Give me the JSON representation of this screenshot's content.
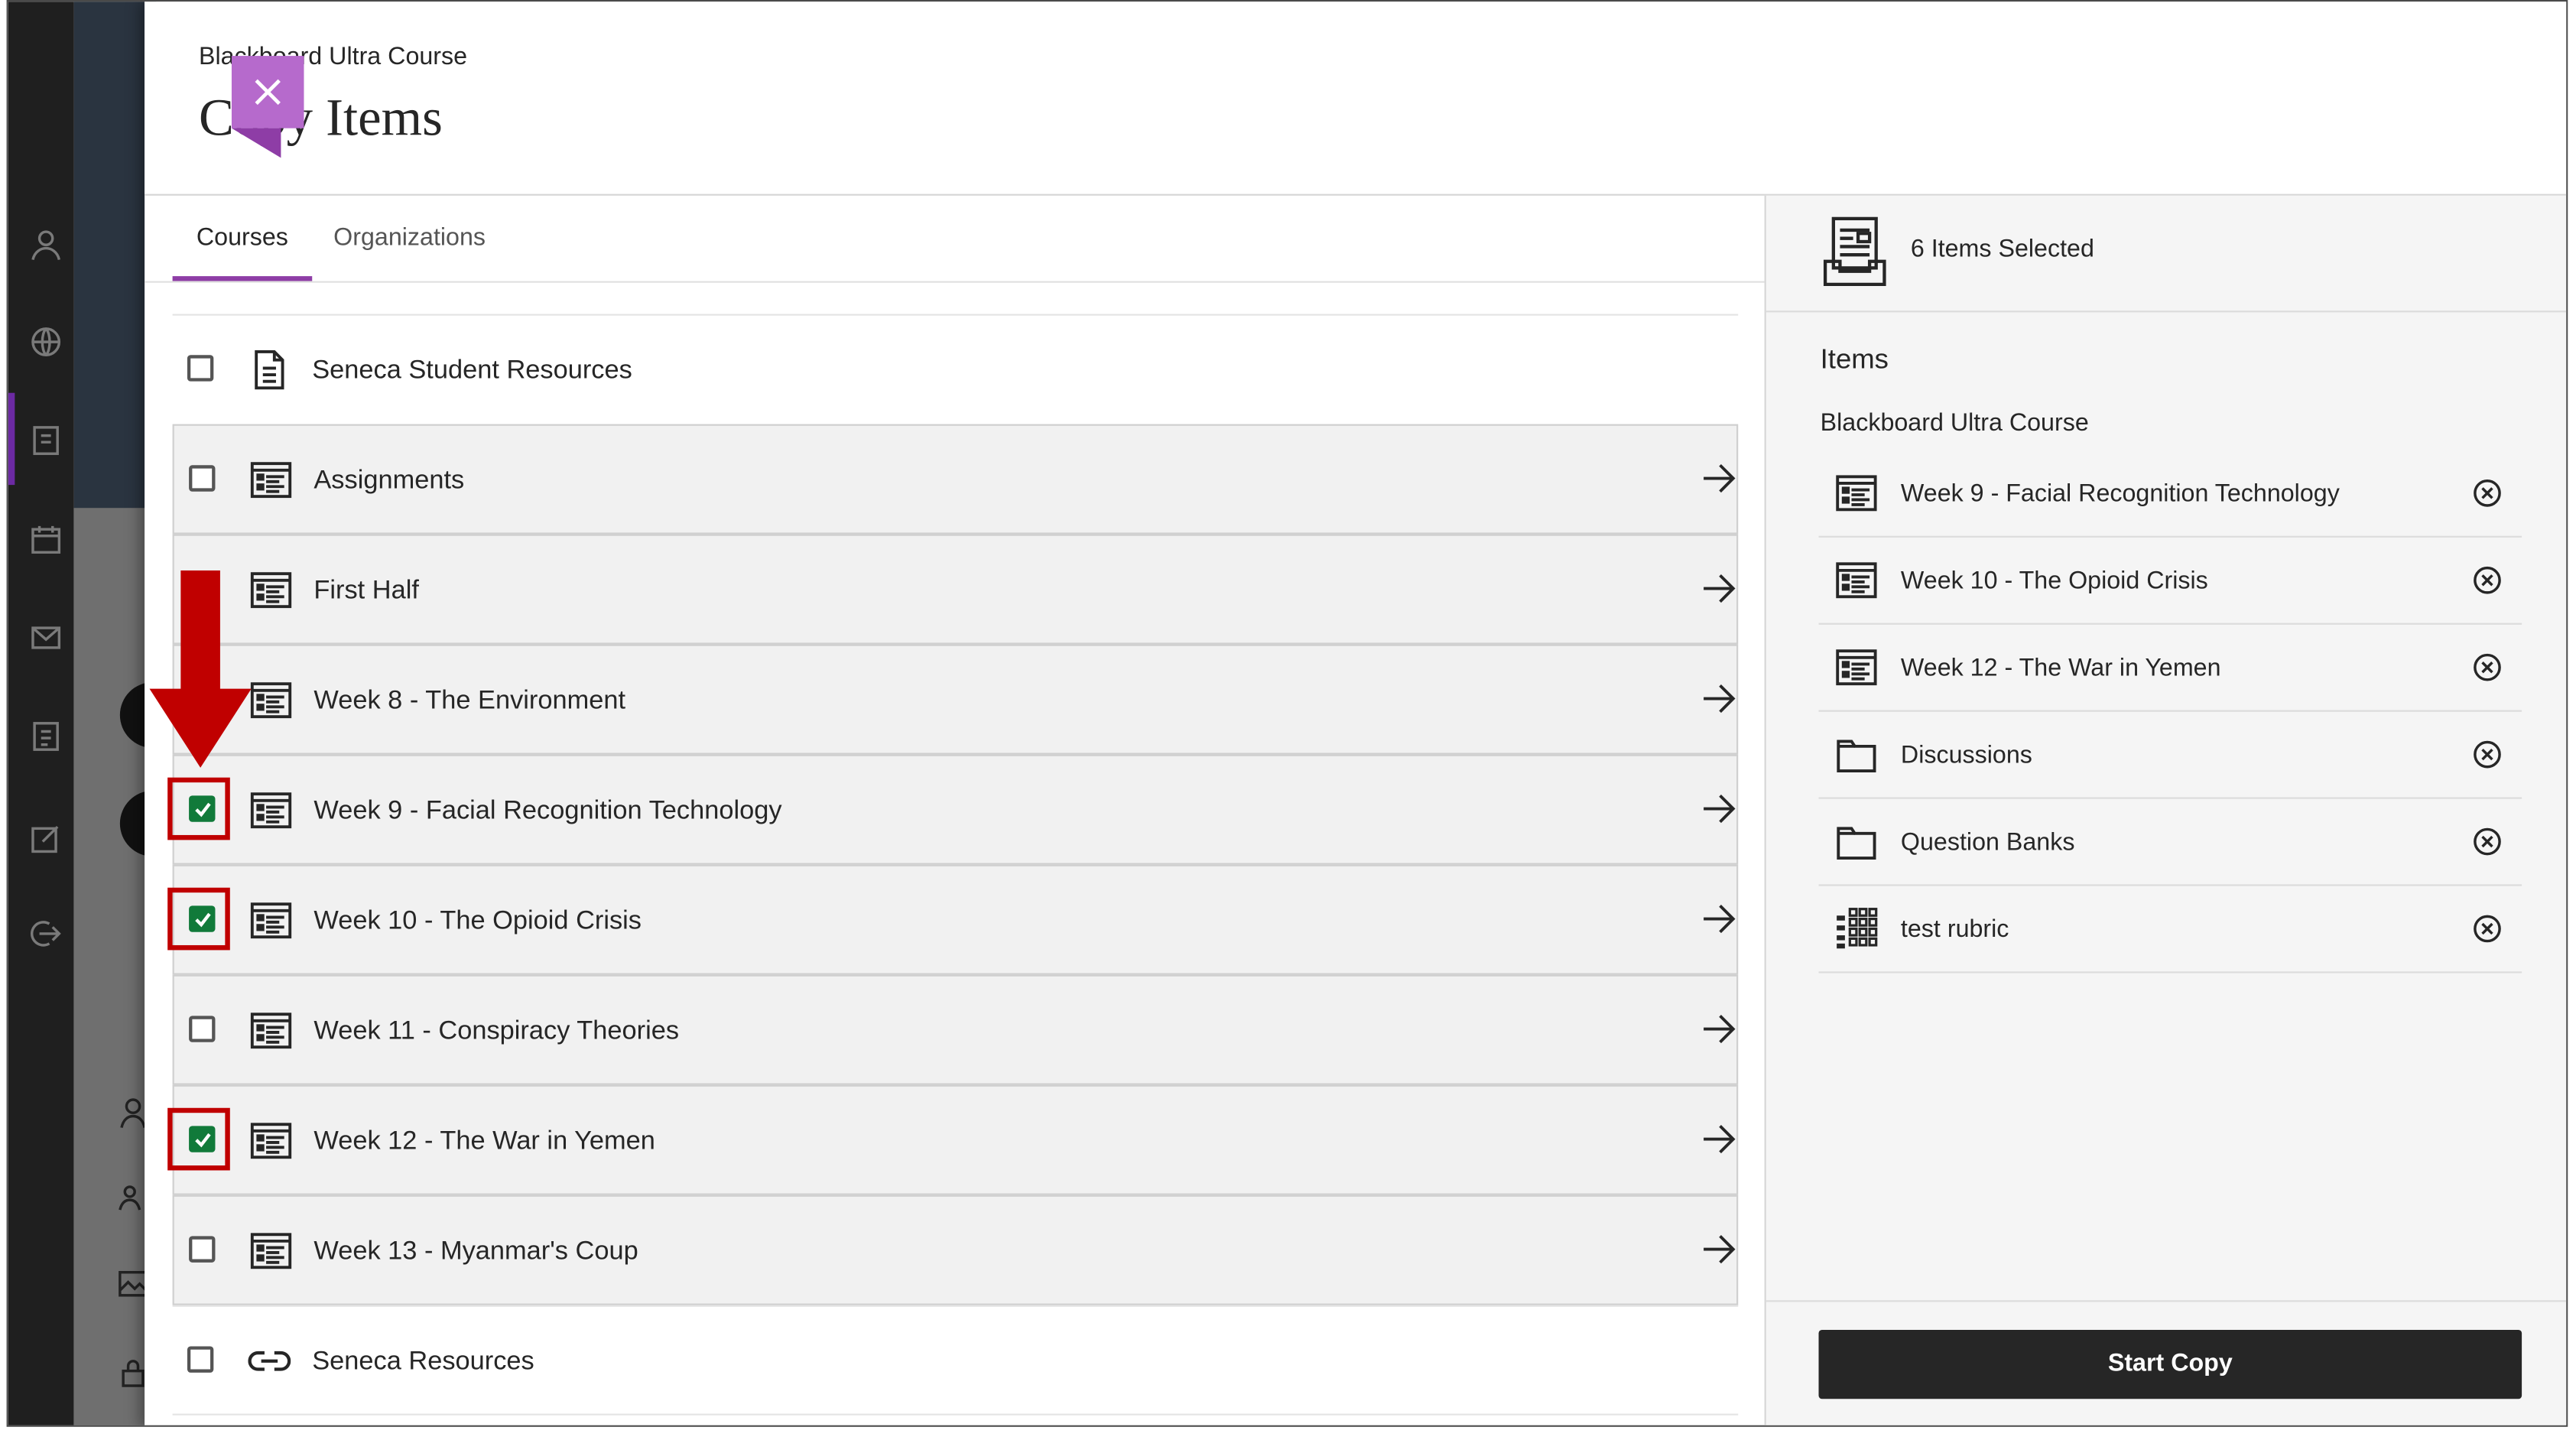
{
  "header": {
    "course_name": "Blackboard Ultra Course",
    "title": "Copy Items",
    "close_label": "Close"
  },
  "tabs": [
    {
      "label": "Courses",
      "active": true
    },
    {
      "label": "Organizations",
      "active": false
    }
  ],
  "course_items": [
    {
      "label": "Seneca Student Resources",
      "icon": "document-icon",
      "checked": false,
      "folder": false
    },
    {
      "label": "Assignments",
      "icon": "content-list-icon",
      "checked": false,
      "folder": true
    },
    {
      "label": "First Half",
      "icon": "content-list-icon",
      "checked": false,
      "folder": true
    },
    {
      "label": "Week 8 - The Environment",
      "icon": "content-list-icon",
      "checked": false,
      "folder": true
    },
    {
      "label": "Week 9 - Facial Recognition Technology",
      "icon": "content-list-icon",
      "checked": true,
      "folder": true
    },
    {
      "label": "Week 10 - The Opioid Crisis",
      "icon": "content-list-icon",
      "checked": true,
      "folder": true
    },
    {
      "label": "Week 11 - Conspiracy Theories",
      "icon": "content-list-icon",
      "checked": false,
      "folder": true
    },
    {
      "label": "Week 12 - The War in Yemen",
      "icon": "content-list-icon",
      "checked": true,
      "folder": true
    },
    {
      "label": "Week 13 - Myanmar's Coup",
      "icon": "content-list-icon",
      "checked": false,
      "folder": true
    },
    {
      "label": "Seneca Resources",
      "icon": "link-icon",
      "checked": false,
      "folder": false
    }
  ],
  "selection": {
    "count_text": "6 Items Selected",
    "items_heading": "Items",
    "course_name": "Blackboard Ultra Course",
    "items": [
      {
        "label": "Week 9 - Facial Recognition Technology",
        "icon": "content-list-icon"
      },
      {
        "label": "Week 10 - The Opioid Crisis",
        "icon": "content-list-icon"
      },
      {
        "label": "Week 12 - The War in Yemen",
        "icon": "content-list-icon"
      },
      {
        "label": "Discussions",
        "icon": "folder-icon"
      },
      {
        "label": "Question Banks",
        "icon": "folder-icon"
      },
      {
        "label": "test rubric",
        "icon": "rubric-icon"
      }
    ]
  },
  "start_copy_label": "Start Copy",
  "colors": {
    "accent": "#8e3da6",
    "close_button": "#b66acc",
    "checkbox_checked": "#117a3a",
    "highlight": "#c00000",
    "primary_button": "#262626"
  }
}
